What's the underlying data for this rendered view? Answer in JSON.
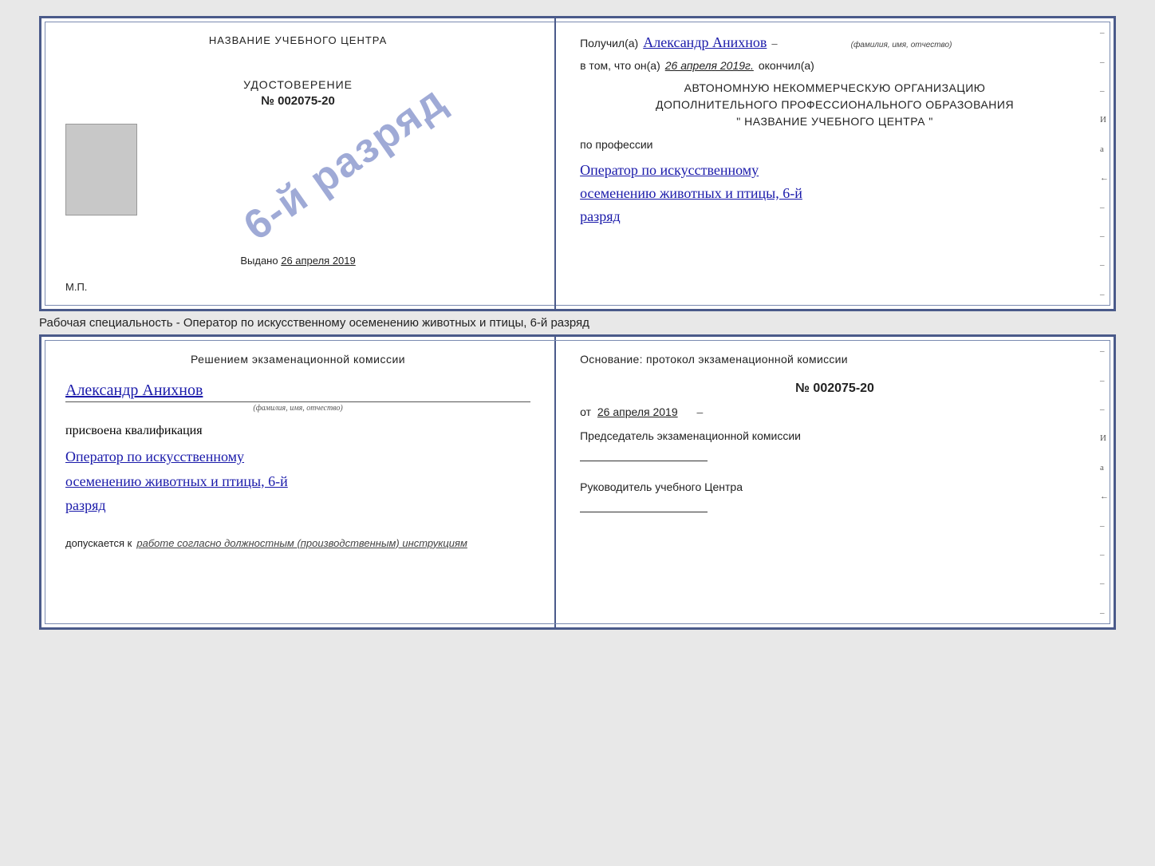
{
  "page": {
    "background": "#e8e8e8"
  },
  "top_cert": {
    "left": {
      "title": "НАЗВАНИЕ УЧЕБНОГО ЦЕНТРА",
      "stamp_text": "6-й разряд",
      "udostoverenie_label": "УДОСТОВЕРЕНИЕ",
      "number": "№ 002075-20",
      "vydano_label": "Выдано",
      "vydano_date": "26 апреля 2019",
      "mp_label": "М.П."
    },
    "right": {
      "poluchil_label": "Получил(а)",
      "recipient_name": "Александр Анихнов",
      "fio_label": "(фамилия, имя, отчество)",
      "vtom_label": "в том, что он(а)",
      "vtom_date": "26 апреля 2019г.",
      "okonchil_label": "окончил(а)",
      "org_line1": "АВТОНОМНУЮ НЕКОММЕРЧЕСКУЮ ОРГАНИЗАЦИЮ",
      "org_line2": "ДОПОЛНИТЕЛЬНОГО ПРОФЕССИОНАЛЬНОГО ОБРАЗОВАНИЯ",
      "org_line3": "\"   НАЗВАНИЕ УЧЕБНОГО ЦЕНТРА   \"",
      "po_professii": "по профессии",
      "profession": "Оператор по искусственному",
      "profession2": "осеменению животных и птицы, 6-й",
      "profession3": "разряд"
    }
  },
  "subtitle": "Рабочая специальность - Оператор по искусственному осеменению животных и птицы, 6-й разряд",
  "bottom_cert": {
    "left": {
      "resheniem": "Решением экзаменационной комиссии",
      "name": "Александр Анихнов",
      "fio_label": "(фамилия, имя, отчество)",
      "prisvoena": "присвоена квалификация",
      "qualification1": "Оператор по искусственному",
      "qualification2": "осеменению животных и птицы, 6-й",
      "qualification3": "разряд",
      "dopuskaetsya": "допускается к",
      "dopusk_text": "работе согласно должностным (производственным) инструкциям"
    },
    "right": {
      "osnovanie": "Основание: протокол экзаменационной комиссии",
      "protocol_num": "№ 002075-20",
      "ot_label": "от",
      "ot_date": "26 апреля 2019",
      "chairman_label": "Председатель экзаменационной комиссии",
      "rukovoditel_label": "Руководитель учебного Центра"
    }
  },
  "decorations": {
    "right_dashes": [
      "-",
      "-",
      "-",
      "И",
      "а",
      "←",
      "-",
      "-",
      "-",
      "-"
    ]
  }
}
